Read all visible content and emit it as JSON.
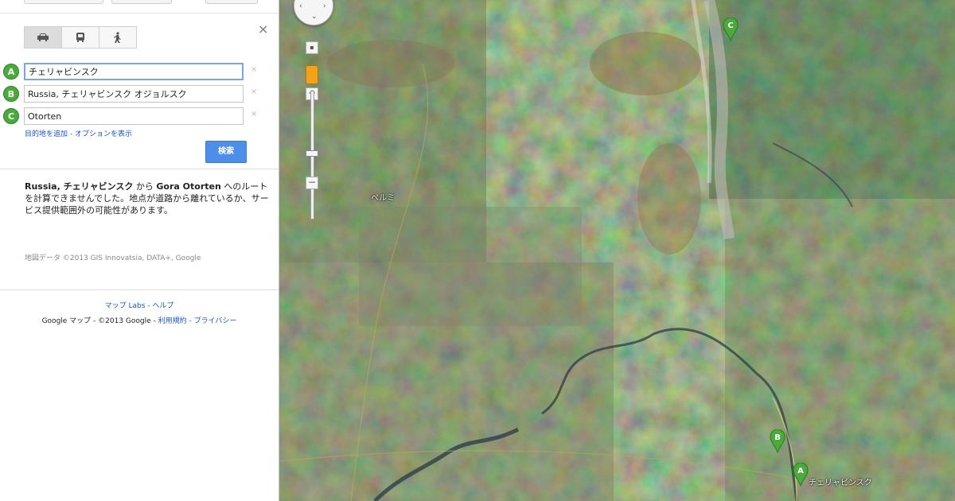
{
  "panel": {
    "modes": [
      "car-icon",
      "transit-icon",
      "walk-icon"
    ],
    "close_icon": "×",
    "waypoints": [
      {
        "letter": "A",
        "value": "チェリャビンスク"
      },
      {
        "letter": "B",
        "value": "Russia, チェリャビンスク オジョルスク"
      },
      {
        "letter": "C",
        "value": "Otorten"
      }
    ],
    "remove_icon": "×",
    "links": "目的地を追加 - オプションを表示",
    "search_label": "検索",
    "message": {
      "origin": "Russia, チェリャビンスク",
      "part1": " から ",
      "destination": "Gora Otorten",
      "part2": " へのルートを計算できませんでした。地点が道路から離れているか、サービス提供範囲外の可能性があります。"
    },
    "map_data": "地図データ ©2013 GIS Innovatsia, DATA+, Google",
    "footer_links": "マップ Labs - ヘルプ",
    "footer_copyright": "Google マップ - ©2013 Google - ",
    "footer_terms": "利用規約 - プライバシー"
  },
  "map": {
    "zoom_in": "+",
    "zoom_out": "−",
    "markers": [
      {
        "letter": "C",
        "color": "#4aaa3c"
      },
      {
        "letter": "B",
        "color": "#4aaa3c"
      },
      {
        "letter": "A",
        "color": "#4aaa3c"
      }
    ],
    "labels": [
      "ペルミ",
      "チェリャビンスク"
    ]
  }
}
